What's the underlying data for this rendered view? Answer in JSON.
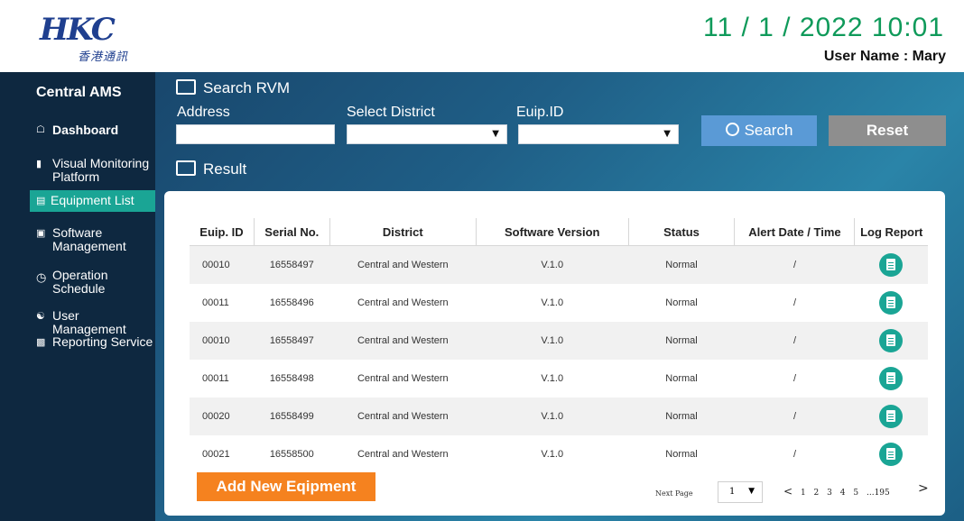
{
  "header": {
    "logo_mark": "HKC",
    "logo_sub": "香港通訊",
    "datetime": "11 / 1 / 2022 10:01",
    "user_label": "User Name : Mary"
  },
  "sidebar": {
    "brand": "Central AMS",
    "items": [
      {
        "label": "Dashboard",
        "icon": "home-icon"
      },
      {
        "label": "Visual Monitoring Platform",
        "icon": "video-camera-icon"
      },
      {
        "label": "Equipment List",
        "icon": "list-icon",
        "active": true
      },
      {
        "label": "Software Management",
        "icon": "window-icon"
      },
      {
        "label": "Operation Schedule",
        "icon": "clock-icon"
      },
      {
        "label": "User Management",
        "icon": "users-icon"
      },
      {
        "label": "Reporting Service",
        "icon": "document-icon"
      }
    ]
  },
  "search": {
    "title": "Search RVM",
    "address_label": "Address",
    "district_label": "Select District",
    "euip_label": "Euip.ID",
    "search_button": "Search",
    "reset_button": "Reset"
  },
  "result": {
    "title": "Result",
    "columns": [
      "Euip. ID",
      "Serial No.",
      "District",
      "Software Version",
      "Status",
      "Alert Date / Time",
      "Log Report"
    ],
    "rows": [
      {
        "id": "00010",
        "serial": "16558497",
        "district": "Central and Western",
        "version": "V.1.0",
        "status": "Normal",
        "alert": "/"
      },
      {
        "id": "00011",
        "serial": "16558496",
        "district": "Central and Western",
        "version": "V.1.0",
        "status": "Normal",
        "alert": "/"
      },
      {
        "id": "00010",
        "serial": "16558497",
        "district": "Central and Western",
        "version": "V.1.0",
        "status": "Normal",
        "alert": "/"
      },
      {
        "id": "00011",
        "serial": "16558498",
        "district": "Central and Western",
        "version": "V.1.0",
        "status": "Normal",
        "alert": "/"
      },
      {
        "id": "00020",
        "serial": "16558499",
        "district": "Central and Western",
        "version": "V.1.0",
        "status": "Normal",
        "alert": "/"
      },
      {
        "id": "00021",
        "serial": "16558500",
        "district": "Central and Western",
        "version": "V.1.0",
        "status": "Normal",
        "alert": "/"
      }
    ],
    "add_button": "Add New Eqipment"
  },
  "pagination": {
    "next_page_label": "Next Page",
    "current_page": "1",
    "prev_arrow": "<",
    "pages": [
      "1",
      "2",
      "3",
      "4",
      "5",
      "...195"
    ],
    "next_arrow": ">"
  },
  "colors": {
    "accent": "#1aa595",
    "search_button": "#5a9ad6",
    "reset_button": "#8e8e8e",
    "add_button": "#f5821f",
    "datetime": "#0f9a5a",
    "sidebar": "#0e2840"
  }
}
